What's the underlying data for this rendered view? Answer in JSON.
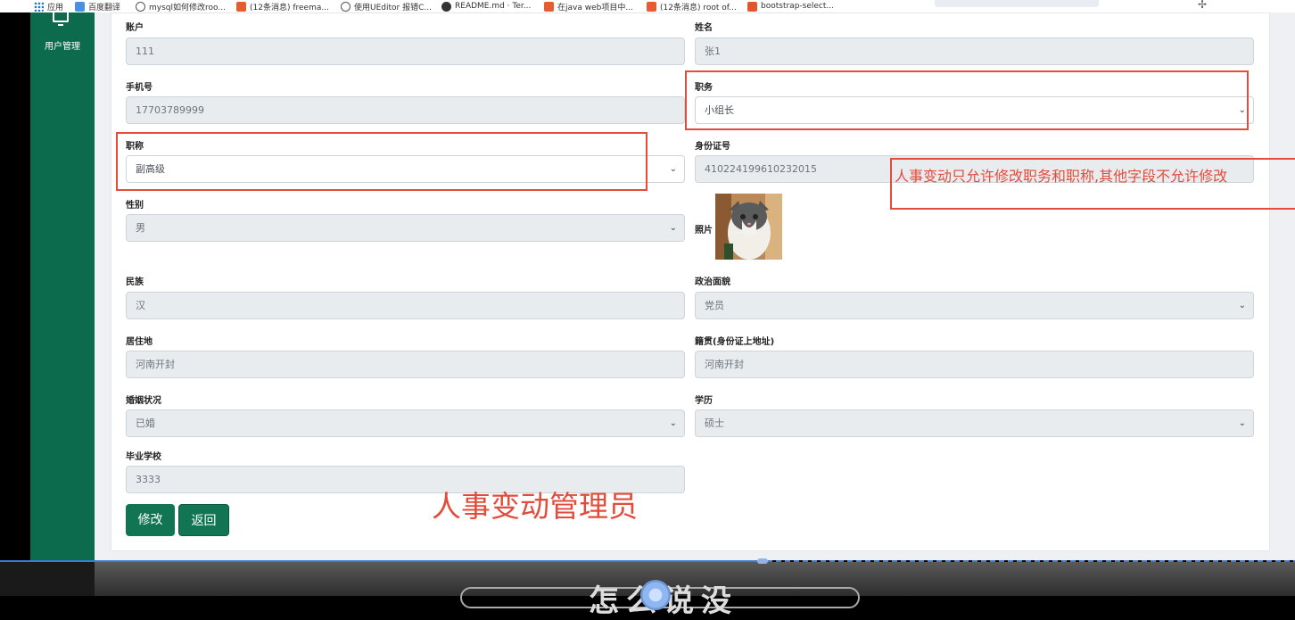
{
  "bookmarks": [
    {
      "icon": "apps-grid-icon",
      "label": "应用"
    },
    {
      "icon": "translate-icon",
      "label": "百度翻译"
    },
    {
      "icon": "link-icon",
      "label": "mysql如何修改roo..."
    },
    {
      "icon": "csdn-icon",
      "label": "(12条消息) freema..."
    },
    {
      "icon": "link-icon",
      "label": "使用UEditor 报错C..."
    },
    {
      "icon": "github-icon",
      "label": "README.md · Ter..."
    },
    {
      "icon": "csdn-icon",
      "label": "在java web项目中..."
    },
    {
      "icon": "csdn-icon",
      "label": "(12条消息) root of..."
    },
    {
      "icon": "bootstrap-icon",
      "label": "bootstrap-select..."
    }
  ],
  "sidebar": {
    "menu_label": "用户管理",
    "icon": "monitor-icon"
  },
  "form": {
    "account": {
      "label": "账户",
      "value": "111"
    },
    "name": {
      "label": "姓名",
      "value": "张1"
    },
    "phone": {
      "label": "手机号",
      "value": "17703789999"
    },
    "position": {
      "label": "职务",
      "value": "小组长"
    },
    "title": {
      "label": "职称",
      "value": "副高级"
    },
    "id_number": {
      "label": "身份证号",
      "value": "410224199610232015"
    },
    "gender": {
      "label": "性别",
      "value": "男"
    },
    "photo": {
      "label": "照片"
    },
    "ethnicity": {
      "label": "民族",
      "value": "汉"
    },
    "political_status": {
      "label": "政治面貌",
      "value": "党员"
    },
    "residence": {
      "label": "居住地",
      "value": "河南开封"
    },
    "native_place": {
      "label": "籍贯(身份证上地址)",
      "value": "河南开封"
    },
    "marital_status": {
      "label": "婚姻状况",
      "value": "已婚"
    },
    "education": {
      "label": "学历",
      "value": "硕士"
    },
    "school": {
      "label": "毕业学校",
      "value": "3333"
    }
  },
  "buttons": {
    "edit": "修改",
    "back": "返回"
  },
  "annotations": {
    "note": "人事变动只允许修改职务和职称,其他字段不允许修改",
    "role": "人事变动管理员",
    "color": "#e34c3b"
  },
  "bottom_caption": "怎么说没"
}
